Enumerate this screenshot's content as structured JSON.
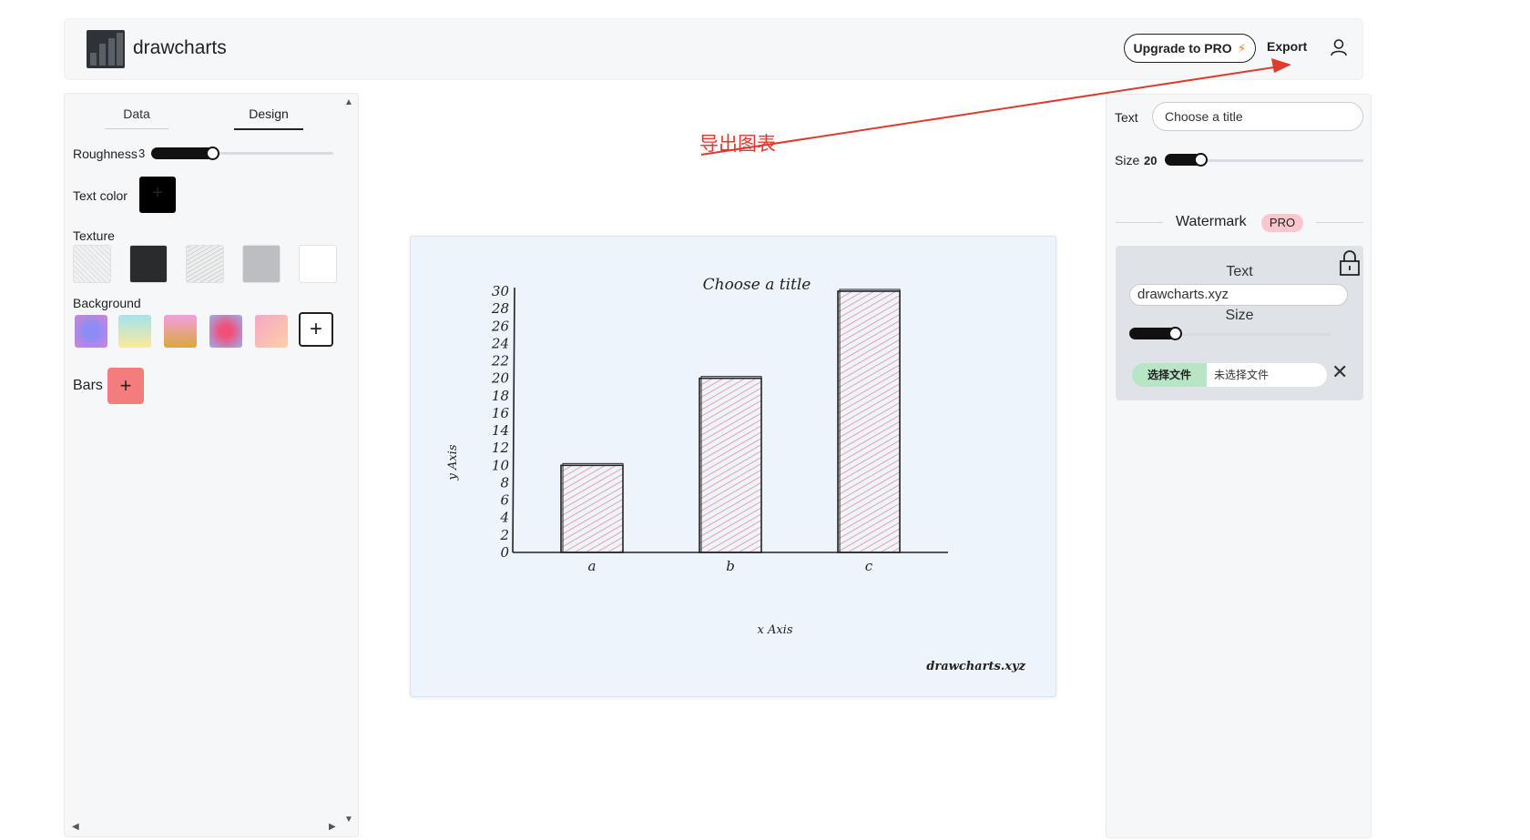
{
  "header": {
    "app_name": "drawcharts",
    "upgrade_label": "Upgrade to PRO",
    "export_label": "Export"
  },
  "left_panel": {
    "tabs": [
      "Data",
      "Design"
    ],
    "active_tab": "Design",
    "roughness_label": "Roughness",
    "roughness_value": "3",
    "text_color_label": "Text color",
    "text_color": "#000000",
    "texture_label": "Texture",
    "background_label": "Background",
    "background_swatches": [
      "#8b86f0",
      "#f5e6a3",
      "#f3a6d3",
      "#ef6fa0",
      "#f8b3b3"
    ],
    "bars_label": "Bars",
    "bars_color": "#f37d7d"
  },
  "annotation": {
    "text": "导出图表",
    "color": "#e03a2f"
  },
  "chart_data": {
    "type": "bar",
    "title": "Choose a title",
    "xlabel": "x Axis",
    "ylabel": "y Axis",
    "categories": [
      "a",
      "b",
      "c"
    ],
    "values": [
      10,
      20,
      30
    ],
    "ylim": [
      0,
      30
    ],
    "yticks": [
      0,
      2,
      4,
      6,
      8,
      10,
      12,
      14,
      16,
      18,
      20,
      22,
      24,
      26,
      28,
      30
    ],
    "bar_fill": "#f0a0a8",
    "watermark": "drawcharts.xyz"
  },
  "right_panel": {
    "text_label": "Text",
    "title_placeholder": "Choose a title",
    "size_label": "Size",
    "size_value": "20",
    "watermark_label": "Watermark",
    "pro_badge": "PRO",
    "wm_text_label": "Text",
    "wm_text_value": "drawcharts.xyz",
    "wm_size_label": "Size",
    "file_button": "选择文件",
    "file_name": "未选择文件"
  }
}
